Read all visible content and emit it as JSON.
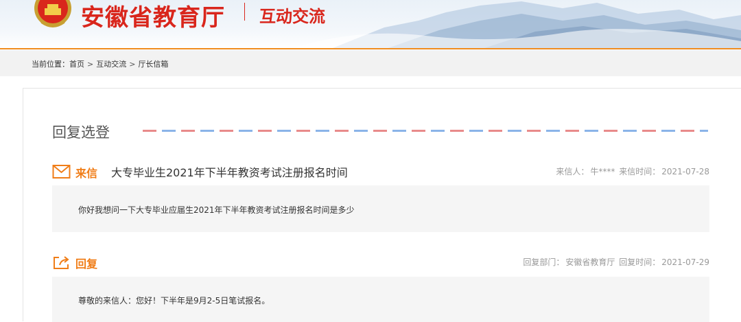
{
  "header": {
    "site_title": "安徽省教育厅",
    "section_title": "互动交流"
  },
  "breadcrumb": {
    "prefix": "当前位置：",
    "items": [
      "首页",
      "互动交流",
      "厅长信箱"
    ],
    "separator": ">"
  },
  "card": {
    "title": "回复选登"
  },
  "letter": {
    "tag": "来信",
    "subject": "大专毕业生2021年下半年教资考试注册报名时间",
    "sender_label": "来信人：",
    "sender": "牛****",
    "date_label": "来信时间：",
    "date": "2021-07-28",
    "body": "你好我想问一下大专毕业应届生2021年下半年教资考试注册报名时间是多少"
  },
  "reply": {
    "tag": "回复",
    "dept_label": "回复部门：",
    "dept": "安徽省教育厅",
    "date_label": "回复时间：",
    "date": "2021-07-29",
    "body": "尊敬的来信人：您好！下半年是9月2-5日笔试报名。"
  },
  "colors": {
    "brand_red": "#d9261c",
    "accent_orange": "#f07d17",
    "airmail_red": "#e88a8a",
    "airmail_blue": "#8ab4e8"
  },
  "icons": {
    "emblem": "national-emblem-icon",
    "letter": "envelope-icon",
    "reply": "reply-share-icon"
  }
}
